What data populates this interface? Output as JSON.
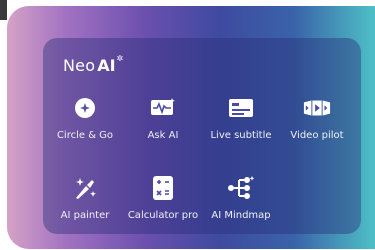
{
  "brand": {
    "text": "Neo",
    "ai": "AI",
    "star": "✲"
  },
  "apps": [
    {
      "label": "Circle & Go",
      "icon": "circle-go-icon"
    },
    {
      "label": "Ask AI",
      "icon": "ask-ai-icon"
    },
    {
      "label": "Live subtitle",
      "icon": "live-subtitle-icon"
    },
    {
      "label": "Video pilot",
      "icon": "video-pilot-icon"
    },
    {
      "label": "AI painter",
      "icon": "ai-painter-icon"
    },
    {
      "label": "Calculator pro",
      "icon": "calculator-icon"
    },
    {
      "label": "AI Mindmap",
      "icon": "mindmap-icon"
    }
  ],
  "colors": {
    "icon": "#ffffff",
    "panel": "#2e2e78",
    "gradient_left": "#d5a2c6",
    "gradient_right": "#4ec0c6"
  }
}
